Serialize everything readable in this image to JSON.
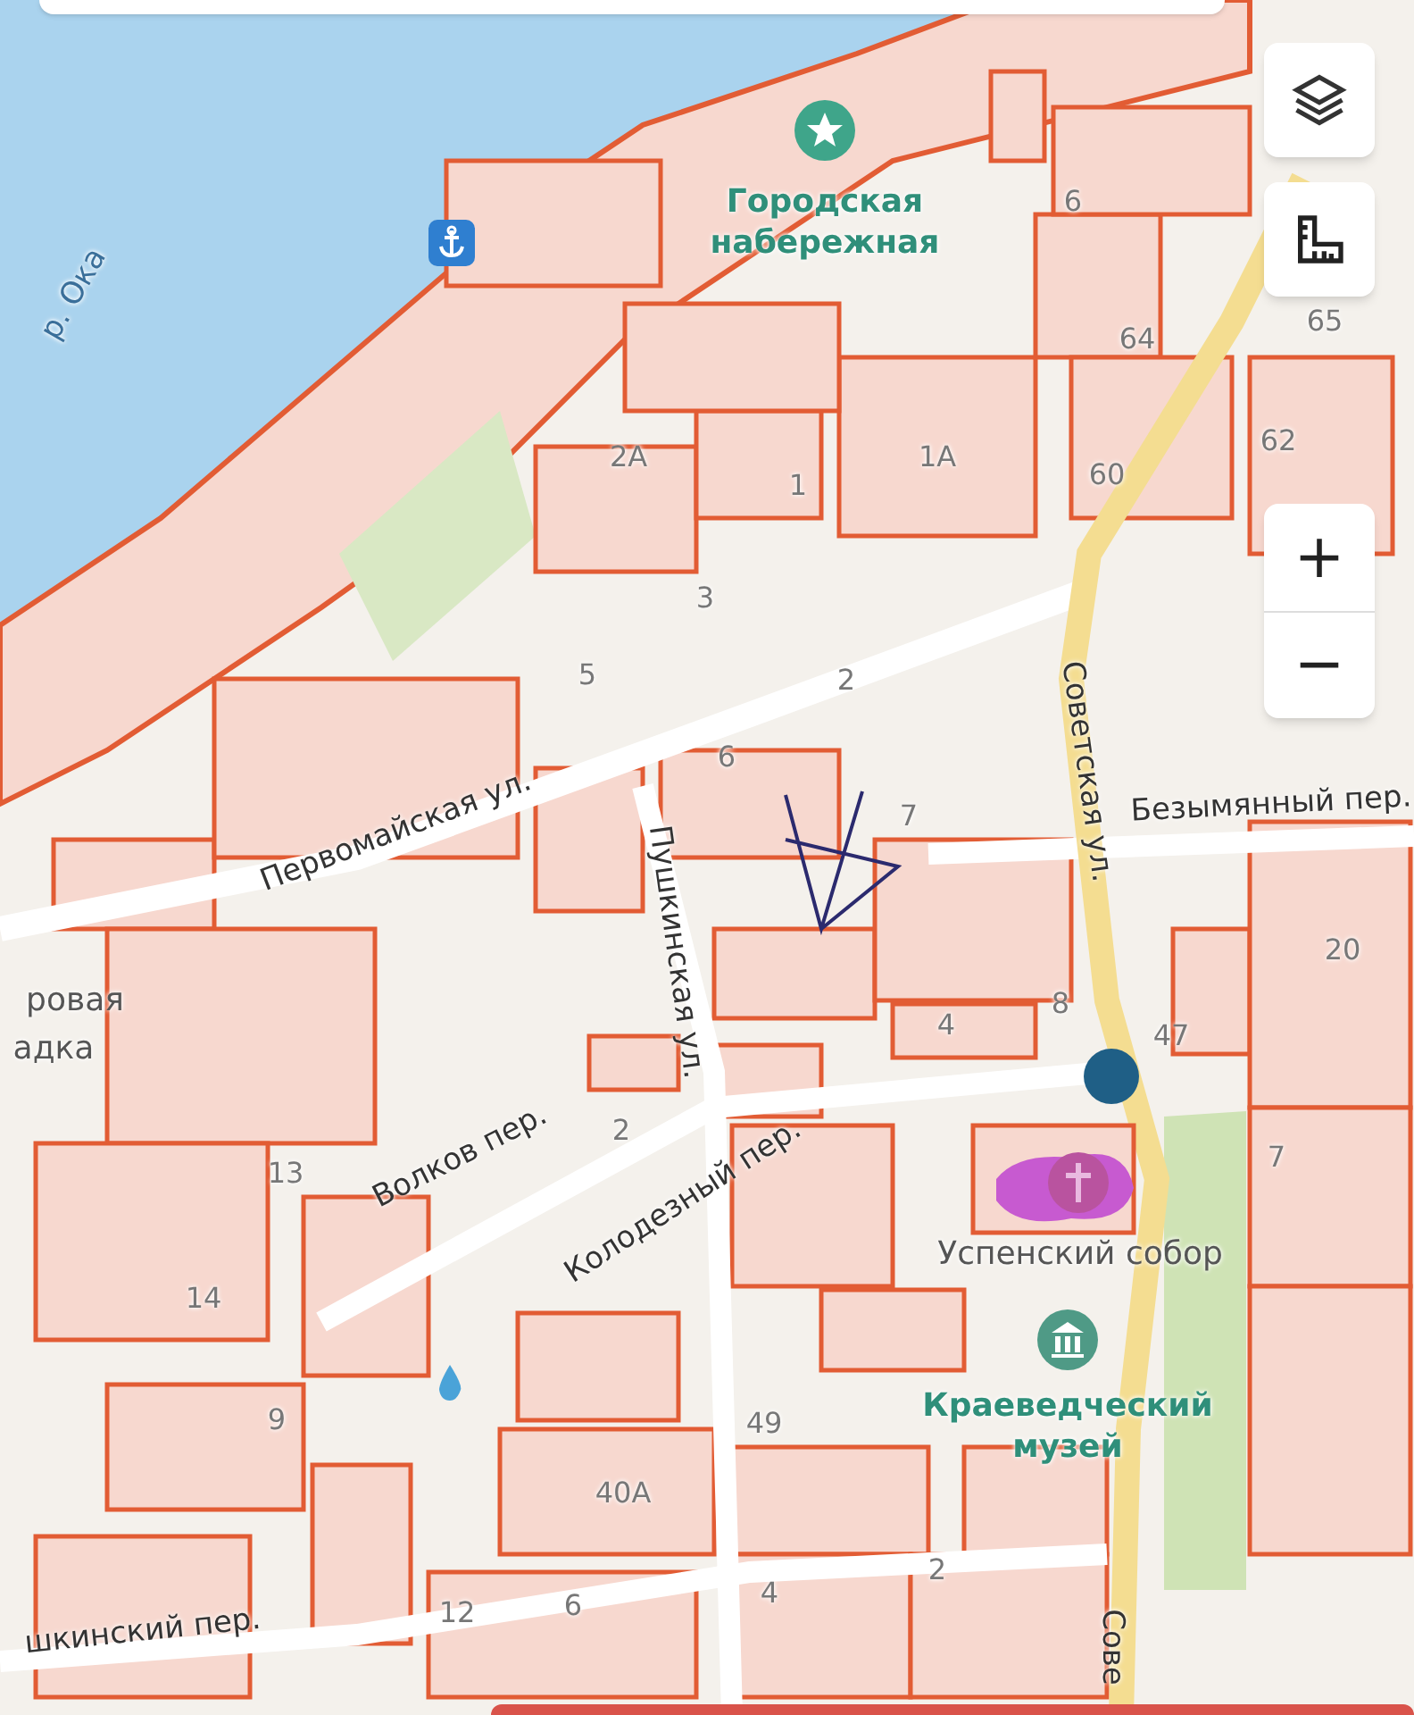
{
  "map": {
    "labels": [
      {
        "kind": "water",
        "text": "р. Ока"
      },
      {
        "kind": "poi",
        "text": "Городская набережная"
      },
      {
        "kind": "street",
        "text": "Первомайская ул."
      },
      {
        "kind": "street",
        "text": "Пушкинская ул."
      },
      {
        "kind": "street",
        "text": "Советская ул."
      },
      {
        "kind": "street",
        "text": "Безымянный пер."
      },
      {
        "kind": "street",
        "text": "Волков пер."
      },
      {
        "kind": "street",
        "text": "Колодезный пер."
      },
      {
        "kind": "place",
        "text": "Успенский собор"
      },
      {
        "kind": "poi",
        "text": "Краеведческий музей"
      },
      {
        "kind": "place",
        "text": "ровая"
      },
      {
        "kind": "place",
        "text": "адка"
      },
      {
        "kind": "street",
        "text": "шкинский пер."
      },
      {
        "kind": "street",
        "text": "Сове"
      },
      {
        "kind": "house",
        "text": "6"
      },
      {
        "kind": "house",
        "text": "64"
      },
      {
        "kind": "house",
        "text": "65"
      },
      {
        "kind": "house",
        "text": "62"
      },
      {
        "kind": "house",
        "text": "60"
      },
      {
        "kind": "house",
        "text": "1А"
      },
      {
        "kind": "house",
        "text": "2А"
      },
      {
        "kind": "house",
        "text": "1"
      },
      {
        "kind": "house",
        "text": "3"
      },
      {
        "kind": "house",
        "text": "5"
      },
      {
        "kind": "house",
        "text": "2"
      },
      {
        "kind": "house",
        "text": "6"
      },
      {
        "kind": "house",
        "text": "7"
      },
      {
        "kind": "house",
        "text": "20"
      },
      {
        "kind": "house",
        "text": "8"
      },
      {
        "kind": "house",
        "text": "4"
      },
      {
        "kind": "house",
        "text": "47"
      },
      {
        "kind": "house",
        "text": "7"
      },
      {
        "kind": "house",
        "text": "2"
      },
      {
        "kind": "house",
        "text": "13"
      },
      {
        "kind": "house",
        "text": "14"
      },
      {
        "kind": "house",
        "text": "9"
      },
      {
        "kind": "house",
        "text": "49"
      },
      {
        "kind": "house",
        "text": "40А"
      },
      {
        "kind": "house",
        "text": "2"
      },
      {
        "kind": "house",
        "text": "4"
      },
      {
        "kind": "house",
        "text": "12"
      },
      {
        "kind": "house",
        "text": "6"
      }
    ]
  },
  "controls": {
    "zoom_in": "+",
    "zoom_out": "−"
  }
}
